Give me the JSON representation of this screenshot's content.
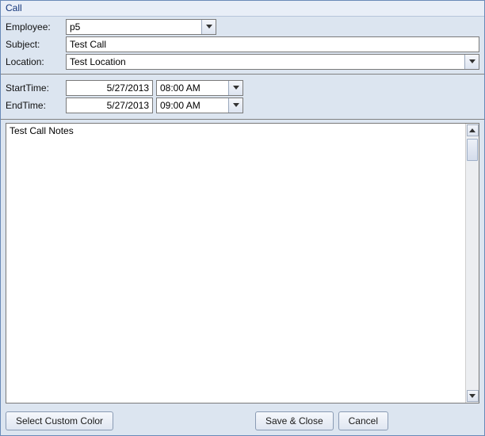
{
  "window": {
    "title": "Call"
  },
  "form": {
    "employee": {
      "label": "Employee:",
      "value": "p5"
    },
    "subject": {
      "label": "Subject:",
      "value": "Test Call"
    },
    "location": {
      "label": "Location:",
      "value": "Test Location"
    }
  },
  "time": {
    "start": {
      "label": "StartTime:",
      "date": "5/27/2013",
      "time": "08:00 AM"
    },
    "end": {
      "label": "EndTime:",
      "date": "5/27/2013",
      "time": "09:00 AM"
    }
  },
  "notes": {
    "value": "Test Call Notes"
  },
  "buttons": {
    "color": "Select Custom Color",
    "save": "Save & Close",
    "cancel": "Cancel"
  }
}
